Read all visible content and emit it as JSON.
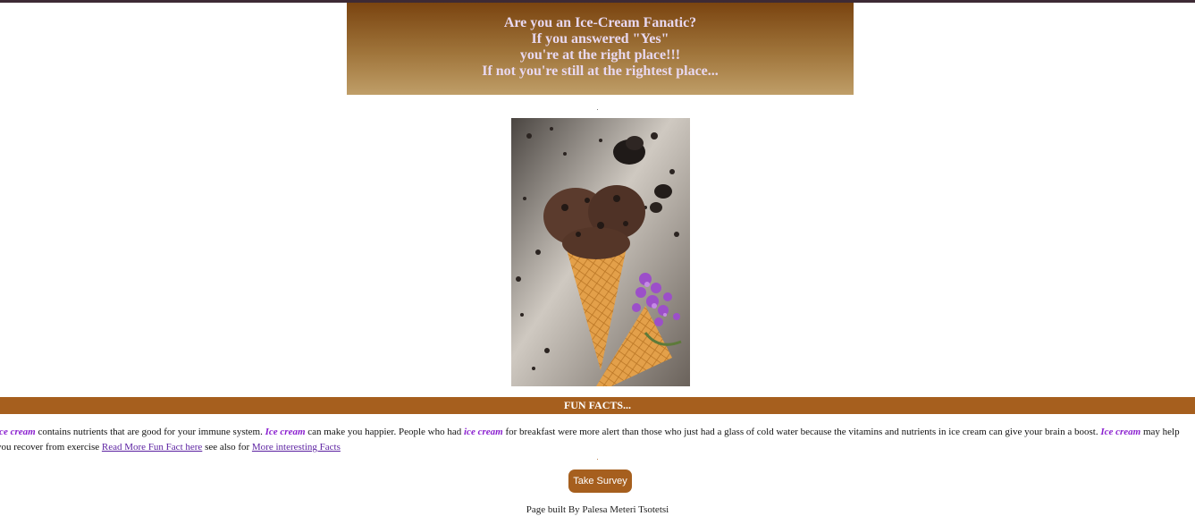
{
  "hero": {
    "lines": [
      "Are you an Ice-Cream Fanatic?",
      "If you answered \"Yes\"",
      "you're at the right place!!!",
      "If not you're still at the rightest place..."
    ]
  },
  "separator_dot": ".",
  "photo": {
    "icon": "ice-cream-cone-photo"
  },
  "fun_facts": {
    "heading": "FUN FACTS...",
    "parts": {
      "em1": "ice cream",
      "t1": " contains nutrients that are good for your immune system. ",
      "em2": "Ice cream",
      "t2": " can make you happier. People who had ",
      "em3": "ice cream",
      "t3": " for breakfast were more alert than those who just had a glass of cold water because the vitamins and nutrients in ice cream can give your brain a boost. ",
      "em4": "Ice cream",
      "t4": " may help you recover from exercise ",
      "link1": "Read More Fun Fact here",
      "t5": " see also for ",
      "link2": "More interesting Facts"
    }
  },
  "survey_button": {
    "label": "Take Survey"
  },
  "footer": {
    "text": "Page built By Palesa Meteri Tsotetsi"
  },
  "colors": {
    "accent": "#a65f1e",
    "emphasis": "#8a1fcf",
    "hero_text": "#e8d8f0"
  }
}
